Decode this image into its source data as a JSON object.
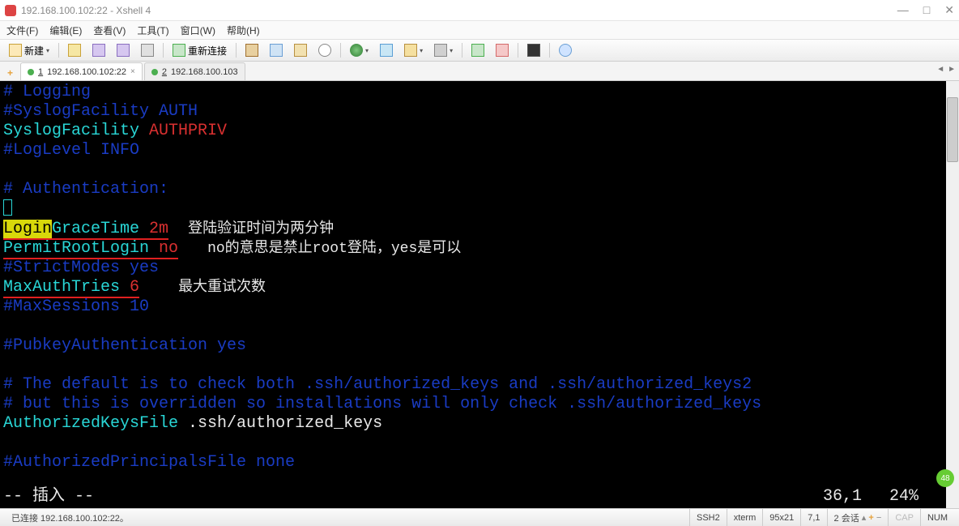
{
  "window": {
    "title": "192.168.100.102:22 - Xshell 4",
    "min": "—",
    "max": "□",
    "close": "✕"
  },
  "menu": {
    "file": "文件(F)",
    "edit": "编辑(E)",
    "view": "查看(V)",
    "tools": "工具(T)",
    "window": "窗口(W)",
    "help": "帮助(H)"
  },
  "toolbar": {
    "new": "新建",
    "reconnect": "重新连接"
  },
  "tabs": [
    {
      "index": "1",
      "label": "192.168.100.102:22",
      "active": true,
      "closable": true
    },
    {
      "index": "2",
      "label": "192.168.100.103",
      "active": false,
      "closable": false
    }
  ],
  "terminal": {
    "l1": "# Logging",
    "l2": "#SyslogFacility AUTH",
    "l3a": "SyslogFacility ",
    "l3b": "AUTHPRIV",
    "l4": "#LogLevel INFO",
    "l5": "# Authentication:",
    "l6a": "Login",
    "l6b": "GraceTime",
    "l6c": " 2m",
    "l6annot": "登陆验证时间为两分钟",
    "l7a": "PermitRootLogin",
    "l7b": " no",
    "l7annot": "no的意思是禁止root登陆，yes是可以",
    "l8": "#StrictModes yes",
    "l9a": "MaxAuthTries",
    "l9b": " 6",
    "l9annot": "最大重试次数",
    "l10": "#MaxSessions 10",
    "l11": "#PubkeyAuthentication yes",
    "l12": "# The default is to check both .ssh/authorized_keys and .ssh/authorized_keys2",
    "l13": "# but this is overridden so installations will only check .ssh/authorized_keys",
    "l14a": "AuthorizedKeysFile",
    "l14b": "      .ssh/authorized_keys",
    "l15": "#AuthorizedPrincipalsFile none",
    "vim_mode": "-- 插入 --",
    "vim_pos": "36,1",
    "vim_pct": "24%"
  },
  "status": {
    "connected": "已连接 192.168.100.102:22。",
    "proto": "SSH2",
    "term": "xterm",
    "size": "95x21",
    "rc": "7,1",
    "sessions": "2 会话",
    "cap": "CAP",
    "num": "NUM"
  },
  "badge": "48"
}
